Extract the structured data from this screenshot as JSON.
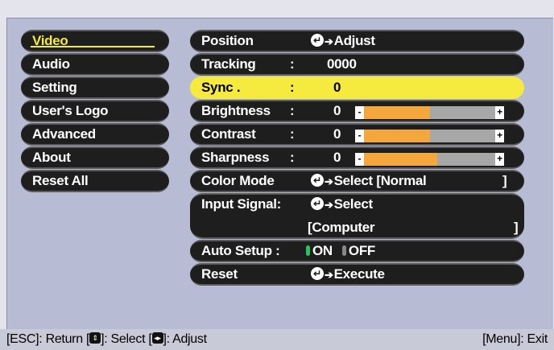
{
  "menu": {
    "items": [
      {
        "label": "Video"
      },
      {
        "label": "Audio"
      },
      {
        "label": "Setting"
      },
      {
        "label": "User's Logo"
      },
      {
        "label": "Advanced"
      },
      {
        "label": "About"
      },
      {
        "label": "Reset All"
      }
    ]
  },
  "settings": {
    "position": {
      "label": "Position",
      "action": "Adjust"
    },
    "tracking": {
      "label": "Tracking",
      "colon": ":",
      "value": "0000"
    },
    "sync": {
      "label": "Sync .",
      "colon": ":",
      "value": "0"
    },
    "brightness": {
      "label": "Brightness",
      "colon": ":",
      "value": "0",
      "level": 0.5
    },
    "contrast": {
      "label": "Contrast",
      "colon": ":",
      "value": "0",
      "level": 0.5
    },
    "sharpness": {
      "label": "Sharpness",
      "colon": ":",
      "value": "0",
      "level": 0.55
    },
    "color_mode": {
      "label": "Color Mode",
      "action": "Select",
      "value": "[Normal",
      "close": "]"
    },
    "input_signal": {
      "label": "Input Signal:",
      "action": "Select",
      "value": "[Computer",
      "close": "]"
    },
    "auto_setup": {
      "label": "Auto Setup :",
      "on": "ON",
      "off": "OFF",
      "selected": "ON"
    },
    "reset": {
      "label": "Reset",
      "action": "Execute"
    }
  },
  "footer": {
    "left_text_1": "[ESC]: Return [",
    "left_text_2": "]: Select [",
    "left_text_3": "]: Adjust",
    "right_text": "[Menu]: Exit"
  },
  "colors": {
    "highlight": "#f7ea3e",
    "bar_fill": "#f4a73c",
    "on_indicator": "#2ec15b",
    "menu_active": "#f2ea3c"
  }
}
